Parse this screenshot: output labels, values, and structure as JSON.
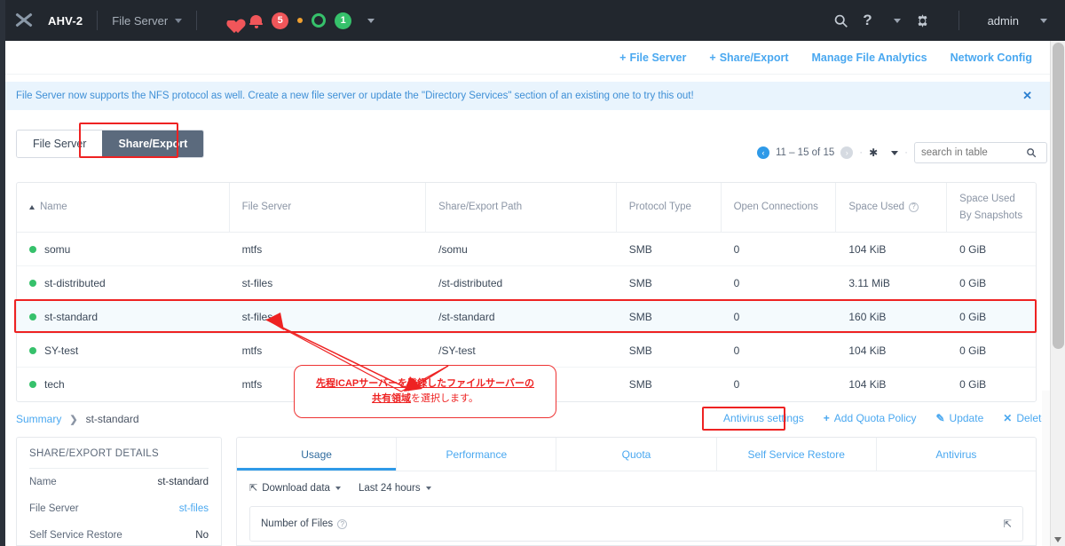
{
  "topbar": {
    "logo_icon": "nutanix-x-logo",
    "cluster": "AHV-2",
    "context": "File Server",
    "alert_count": "5",
    "ok_count": "1",
    "search_icon": "search-icon",
    "help_icon": "question-mark-icon",
    "settings_icon": "gear-icon",
    "user": "admin"
  },
  "actionbar": {
    "items": [
      {
        "label": "File Server",
        "plus": "+"
      },
      {
        "label": "Share/Export",
        "plus": "+"
      },
      {
        "label": "Manage File Analytics",
        "plus": ""
      },
      {
        "label": "Network Config",
        "plus": ""
      }
    ]
  },
  "banner": {
    "text": "File Server now supports the NFS protocol as well. Create a new file server or update the \"Directory Services\" section of an existing one to try this out!",
    "close": "✕"
  },
  "segmented": {
    "file_server": "File Server",
    "share_export": "Share/Export"
  },
  "pagination": {
    "range": "11 – 15 of 15",
    "prev_icon": "chevron-left-icon",
    "next_icon": "chevron-right-icon",
    "gear_icon": "gear-icon",
    "sep": "·"
  },
  "search": {
    "placeholder": "search in table",
    "value": "",
    "icon": "search-icon"
  },
  "table": {
    "columns": [
      "Name",
      "File Server",
      "Share/Export Path",
      "Protocol Type",
      "Open Connections",
      "Space Used",
      "Space Used By Snapshots"
    ],
    "space_used_help": "?",
    "rows": [
      {
        "status": "ok",
        "name": "somu",
        "file_server": "mtfs",
        "path": "/somu",
        "protocol": "SMB",
        "connections": "0",
        "space_used": "104 KiB",
        "snapshots": "0 GiB",
        "selected": false
      },
      {
        "status": "ok",
        "name": "st-distributed",
        "file_server": "st-files",
        "path": "/st-distributed",
        "protocol": "SMB",
        "connections": "0",
        "space_used": "3.11 MiB",
        "snapshots": "0 GiB",
        "selected": false
      },
      {
        "status": "ok",
        "name": "st-standard",
        "file_server": "st-files",
        "path": "/st-standard",
        "protocol": "SMB",
        "connections": "0",
        "space_used": "160 KiB",
        "snapshots": "0 GiB",
        "selected": true
      },
      {
        "status": "ok",
        "name": "SY-test",
        "file_server": "mtfs",
        "path": "/SY-test",
        "protocol": "SMB",
        "connections": "0",
        "space_used": "104 KiB",
        "snapshots": "0 GiB",
        "selected": false
      },
      {
        "status": "ok",
        "name": "tech",
        "file_server": "mtfs",
        "path": "",
        "protocol": "SMB",
        "connections": "0",
        "space_used": "104 KiB",
        "snapshots": "0 GiB",
        "selected": false
      }
    ]
  },
  "callout": {
    "line1_underlined": "先程ICAPサーバーを登録したファイルサーバーの",
    "line2_underlined": "共有領域",
    "line2_rest": "を選択します。"
  },
  "breadcrumb": {
    "root": "Summary",
    "chevron": "❯",
    "current": "st-standard"
  },
  "detail_actions": [
    {
      "label": "Antivirus settings",
      "glyph": ""
    },
    {
      "label": "Add Quota Policy",
      "glyph": "+"
    },
    {
      "label": "Update",
      "glyph": "✎"
    },
    {
      "label": "Delete",
      "glyph": "✕"
    }
  ],
  "details_panel": {
    "title": "SHARE/EXPORT DETAILS",
    "rows": [
      {
        "key": "Name",
        "value": "st-standard",
        "link": false
      },
      {
        "key": "File Server",
        "value": "st-files",
        "link": true
      },
      {
        "key": "Self Service Restore",
        "value": "No",
        "link": false
      }
    ]
  },
  "detail_tabs": [
    {
      "label": "Usage",
      "active": true
    },
    {
      "label": "Performance",
      "active": false
    },
    {
      "label": "Quota",
      "active": false
    },
    {
      "label": "Self Service Restore",
      "active": false
    },
    {
      "label": "Antivirus",
      "active": false
    }
  ],
  "detail_toolbar": {
    "download": "Download data",
    "download_icon": "external-link-icon",
    "timerange": "Last 24 hours"
  },
  "chart_card": {
    "title": "Number of Files",
    "help": "?",
    "expand_icon": "external-link-icon"
  },
  "colors": {
    "accent_blue": "#4aa8f0",
    "nav_dark": "#22272e",
    "status_green": "#36c16b",
    "alert_red": "#f0565a",
    "highlight_red": "#ee2222",
    "selected_row": "#f4fafd"
  }
}
